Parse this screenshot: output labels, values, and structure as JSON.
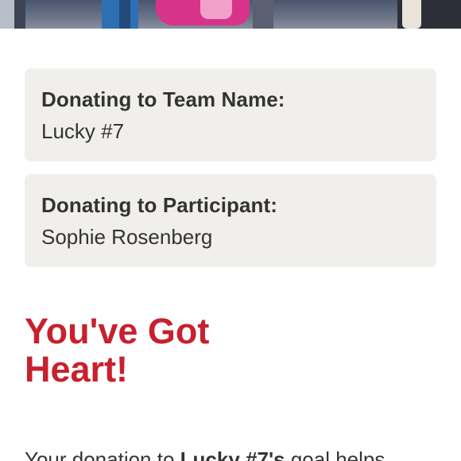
{
  "hero": {
    "image_description_name": "event-photo"
  },
  "team_card": {
    "label": "Donating to Team Name:",
    "value": "Lucky #7"
  },
  "participant_card": {
    "label": "Donating to Participant:",
    "value": "Sophie Rosenberg"
  },
  "headline": {
    "line1": "You've Got",
    "line2": "Heart!"
  },
  "body": {
    "prefix": "Your donation to ",
    "team_possessive": "Lucky #7's",
    "suffix": " goal helps"
  },
  "colors": {
    "accent": "#c8202e",
    "card_bg": "#f0efeb",
    "text": "#333333"
  }
}
